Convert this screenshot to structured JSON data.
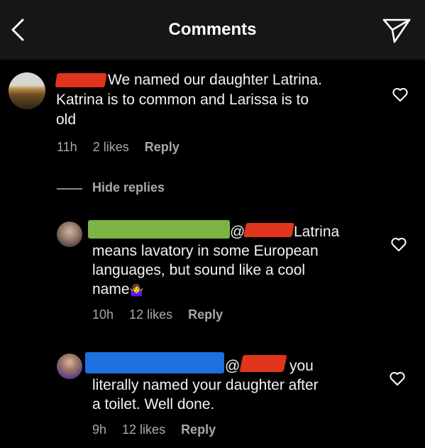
{
  "header": {
    "title": "Comments",
    "back_icon": "chevron-left-icon",
    "send_icon": "paper-plane-icon"
  },
  "comments": [
    {
      "lines": [
        "We named our daughter Latrina.",
        "Katrina is to common and Larissa is to",
        "old"
      ],
      "time": "11h",
      "likes": "2 likes",
      "reply": "Reply"
    }
  ],
  "hide_replies": "Hide replies",
  "replies": [
    {
      "mention": "@",
      "lines_after_mention": "Latrina",
      "lines": [
        "means lavatory in some European",
        "languages, but sound like a cool",
        "name"
      ],
      "emoji": "🤷‍♀️",
      "time": "10h",
      "likes": "12 likes",
      "reply": "Reply"
    },
    {
      "mention": "@",
      "lines_after_mention": "you",
      "lines": [
        "literally named your daughter after",
        "a toilet. Well done."
      ],
      "time": "9h",
      "likes": "12 likes",
      "reply": "Reply"
    }
  ],
  "colors": {
    "background": "#000000",
    "header": "#161616",
    "redact_red": "#e0341c",
    "redact_green": "#7cb342",
    "redact_blue": "#1e6fe0",
    "muted": "#a8a8a8"
  }
}
